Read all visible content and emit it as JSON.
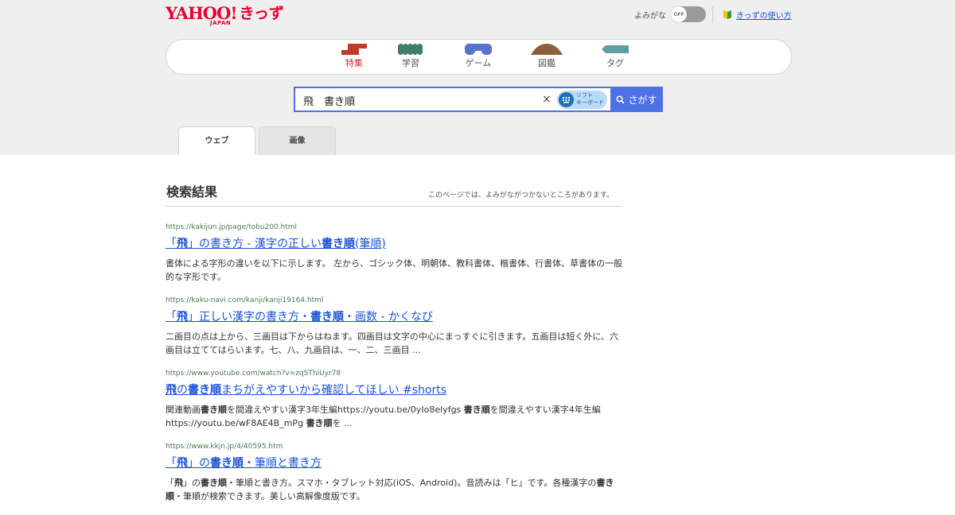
{
  "header": {
    "logo_yahoo": "YAHOO!",
    "logo_japan": "JAPAN",
    "logo_kids": "きっず",
    "yomigana_label": "よみがな",
    "yomigana_toggle": "OFF",
    "help_link": "きっずの使い方"
  },
  "categories": [
    {
      "label": "特集",
      "icon": "feature-icon",
      "color": "#c0392b",
      "active": true
    },
    {
      "label": "学習",
      "icon": "study-icon",
      "color": "#3f7f66",
      "active": false
    },
    {
      "label": "ゲーム",
      "icon": "game-icon",
      "color": "#5b72c9",
      "active": false
    },
    {
      "label": "図鑑",
      "icon": "encyclopedia-icon",
      "color": "#8b5e3c",
      "active": false
    },
    {
      "label": "タグ",
      "icon": "tag-icon",
      "color": "#5f9ea0",
      "active": false
    }
  ],
  "search": {
    "query": "飛　書き順",
    "clear_symbol": "×",
    "softkb_line1": "ソフト",
    "softkb_line2": "キーボード",
    "button_label": "さがす"
  },
  "tabs": [
    {
      "label": "ウェブ",
      "active": true
    },
    {
      "label": "画像",
      "active": false
    }
  ],
  "results_header": {
    "title": "検索結果",
    "note": "このページでは、よみがながつかないところがあります。"
  },
  "results": [
    {
      "url": "https://kakijun.jp/page/tobu200.html",
      "title": "「<b>飛</b>」の書き方 - 漢字の正しい<b>書き順</b>(筆順)",
      "snippet": "書体による字形の違いを以下に示します。 左から、ゴシック体、明朝体、教科書体、楷書体、行書体、草書体の一般的な字形です。"
    },
    {
      "url": "https://kaku-navi.com/kanji/kanji19164.html",
      "title": "「<b>飛</b>」正しい漢字の書き方・<b>書き順</b>・画数 - かくなび",
      "snippet": "二画目の点は上から、三画目は下からはねます。四画目は文字の中心にまっすぐに引きます。五画目は短く外に、六画目は立ててはらいます。七、八、九画目は、一、二、三画目 ..."
    },
    {
      "url": "https://www.youtube.com/watch?v=zqSThiUyr78",
      "title": "<b>飛</b>の<b>書き順</b>まちがえやすいから確認してほしい #shorts",
      "snippet": "関連動画<b>書き順</b>を間違えやすい漢字3年生編https://youtu.be/0yIo8elyfgs <b>書き順</b>を間違えやすい漢字4年生編https://youtu.be/wF8AE4B_mPg <b>書き順</b>を ..."
    },
    {
      "url": "https://www.kkjn.jp/4/40595.htm",
      "title": "「<b>飛</b>」の<b>書き順</b>・筆順と書き方",
      "snippet": "「<b>飛</b>」の<b>書き順</b>・筆順と書き方。スマホ・タブレット対応(iOS、Android)。音読みは「ヒ」です。各種漢字の<b>書き順</b>・筆順が検索できます。美しい高解像度版です。"
    }
  ]
}
